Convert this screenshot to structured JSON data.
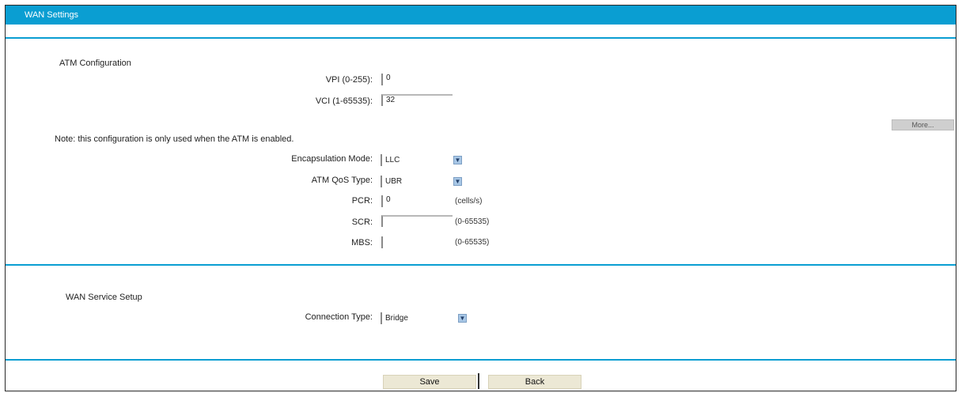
{
  "title": "WAN Settings",
  "atm": {
    "section_title": "ATM Configuration",
    "vpi_label": "VPI (0-255):",
    "vpi_value": "0",
    "vci_label": "VCI (1-65535):",
    "vci_value": "32",
    "more_button": "More..."
  },
  "encap": {
    "section_title": "Note: this configuration is only used when the ATM is enabled.",
    "mode_label": "Encapsulation Mode:",
    "mode_value": "LLC",
    "qos_label": "ATM QoS Type:",
    "qos_value": "UBR",
    "pcr_label": "PCR:",
    "pcr_value": "0",
    "pcr_hint": "(cells/s)",
    "scr_label": "SCR:",
    "scr_value": "",
    "scr_hint": "(0-65535)",
    "mbs_label": "MBS:",
    "mbs_value": "",
    "mbs_hint": "(0-65535)"
  },
  "service": {
    "section_title": "WAN Service Setup",
    "conn_label": "Connection Type:",
    "conn_value": "Bridge"
  },
  "buttons": {
    "save": "Save",
    "back": "Back"
  },
  "colors": {
    "accent": "#0a9ed2",
    "button": "#ece8d5"
  }
}
